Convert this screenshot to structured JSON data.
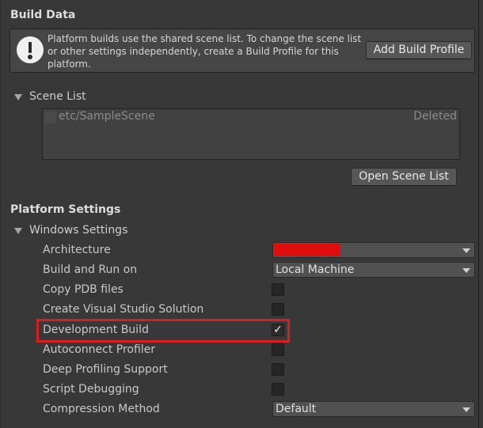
{
  "build_data": {
    "title": "Build Data",
    "help_text": "Platform builds use the shared scene list. To change the scene list or other settings independently, create a Build Profile for this platform.",
    "add_profile_button": "Add Build Profile"
  },
  "scene_list": {
    "title": "Scene List",
    "scenes": [
      {
        "name": "etc/SampleScene",
        "status": "Deleted",
        "enabled": false
      }
    ],
    "open_button": "Open Scene List"
  },
  "platform_settings": {
    "title": "Platform Settings",
    "windows_title": "Windows Settings",
    "architecture": {
      "label": "Architecture",
      "value": "",
      "redacted_color": "#e00d0d"
    },
    "build_run_on": {
      "label": "Build and Run on",
      "value": "Local Machine"
    },
    "copy_pdb": {
      "label": "Copy PDB files",
      "checked": false
    },
    "create_vs": {
      "label": "Create Visual Studio Solution",
      "checked": false
    },
    "dev_build": {
      "label": "Development Build",
      "checked": true,
      "check_glyph": "✓"
    },
    "autoconnect": {
      "label": "Autoconnect Profiler",
      "checked": false
    },
    "deep_profiling": {
      "label": "Deep Profiling Support",
      "checked": false
    },
    "script_debugging": {
      "label": "Script Debugging",
      "checked": false
    },
    "compression": {
      "label": "Compression Method",
      "value": "Default"
    }
  },
  "colors": {
    "background": "#383838",
    "highlight_box": "#d81e1e"
  },
  "icons": {
    "warning": "warning-icon",
    "foldout": "triangle-down-icon",
    "dropdown": "chevron-down-icon",
    "check": "checkmark-icon"
  }
}
